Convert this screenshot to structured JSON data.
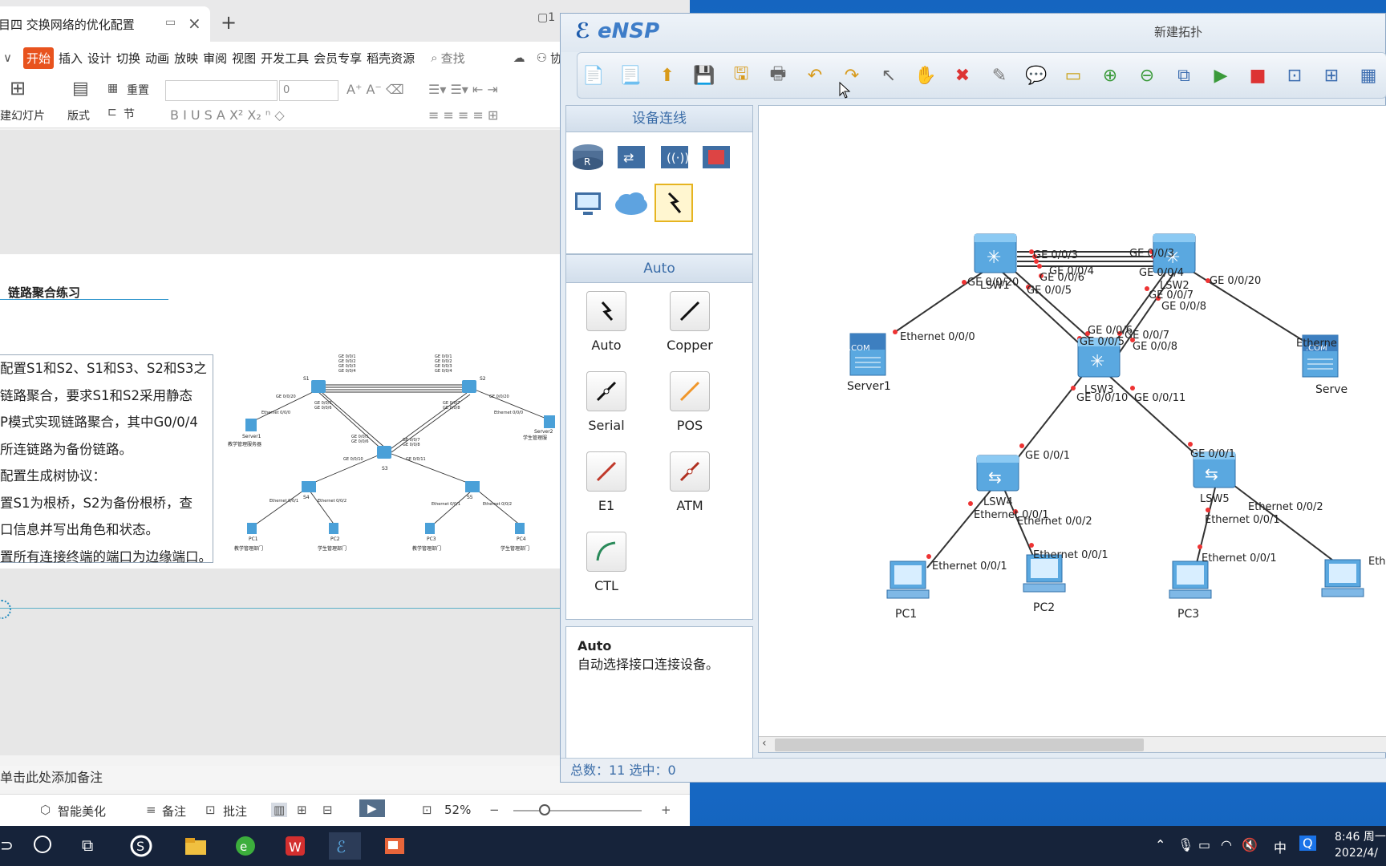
{
  "wps": {
    "tab_title": "目四 交换网络的优化配置",
    "menu": [
      "开始",
      "插入",
      "设计",
      "切换",
      "动画",
      "放映",
      "审阅",
      "视图",
      "开发工具",
      "会员专享",
      "稻壳资源"
    ],
    "search_placeholder": "查找",
    "collab_label": "协作",
    "ribbon": {
      "new_slide": "建幻灯片",
      "layout": "版式",
      "reset": "重置",
      "section": "节",
      "font_size": "0"
    },
    "slide": {
      "title": "链路聚合练习",
      "lines": [
        "配置S1和S2、S1和S3、S2和S3之",
        "链路聚合，要求S1和S2采用静态",
        "P模式实现链路聚合，其中G0/0/4",
        "所连链路为备份链路。",
        "配置生成树协议：",
        "置S1为根桥，S2为备份根桥，查",
        "口信息并写出角色和状态。",
        "置所有连接终端的端口为边缘端口。"
      ],
      "mini": {
        "s1": "S1",
        "s2": "S2",
        "s3": "S3",
        "s4": "S4",
        "s5": "S5",
        "server1": "Server1",
        "server1_dept": "教学管理服务器",
        "server2": "Server2",
        "server2_dept": "学生管理服",
        "pc1": "PC1",
        "pc2": "PC2",
        "pc3": "PC3",
        "pc4": "PC4",
        "pc1_dept": "教学管理部门",
        "pc2_dept": "学生管理部门",
        "pc3_dept": "教学管理部门",
        "pc4_dept": "学生管理部门",
        "ge_a": "GE 0/0/1",
        "ge_b": "GE 0/0/2",
        "ge_c": "GE 0/0/3",
        "ge_d": "GE 0/0/4",
        "ge20": "GE 0/0/20",
        "ge5": "GE 0/0/5",
        "ge6": "GE 0/0/6",
        "ge7": "GE 0/0/7",
        "ge8": "GE 0/0/8",
        "ge10": "GE 0/0/10",
        "ge11": "GE 0/0/11",
        "eth0": "Ethernet 0/0/0",
        "eth1": "Ethernet 0/0/1",
        "eth2": "Ethernet 0/0/2"
      }
    },
    "note": "单击此处添加备注",
    "status": {
      "beautify": "智能美化",
      "notes": "备注",
      "comment": "批注",
      "zoom": "52%"
    }
  },
  "ensp": {
    "logo": "eNSP",
    "window_title": "新建拓扑",
    "panel_title": "设备连线",
    "cable_section": "Auto",
    "cables": [
      "Auto",
      "Copper",
      "Serial",
      "POS",
      "E1",
      "ATM",
      "CTL"
    ],
    "desc_title": "Auto",
    "desc_text": "自动选择接口连接设备。",
    "status": "总数：11  选中：0",
    "topology": {
      "lsw1": "LSW1",
      "lsw2": "LSW2",
      "lsw3": "LSW3",
      "lsw4": "LSW4",
      "lsw5": "LSW5",
      "server1": "Server1",
      "server2": "Serve",
      "pc1": "PC1",
      "pc2": "PC2",
      "pc3": "PC3",
      "port_ge20_a": "GE 0/0/20",
      "port_ge20_b": "GE 0/0/20",
      "port_eth000": "Ethernet 0/0/0",
      "port_eth_r": "Etherne",
      "port_ge3": "GE 0/0/3",
      "port_ge4": "GE 0/0/4",
      "port_ge6": "GE 0/0/6",
      "port_ge5": "GE 0/0/5",
      "port_s2_a": "GE 0/0/3",
      "port_s2_b": "GE 0/0/4",
      "port_ge7": "GE 0/0/7",
      "port_ge8": "GE 0/0/8",
      "port_lsw3_6": "GE 0/0/6",
      "port_lsw3_5": "GE 0/0/5",
      "port_lsw3_7": "GE 0/0/7",
      "port_lsw3_8": "GE 0/0/8",
      "port_ge10": "GE 0/0/10",
      "port_ge11": "GE 0/0/11",
      "port_lsw4_ge1": "GE 0/0/1",
      "port_lsw5_ge1": "GE 0/0/1",
      "port_lsw4_eth1": "Ethernet 0/0/1",
      "port_lsw4_eth2": "Ethernet 0/0/2",
      "port_lsw5_eth1": "Ethernet 0/0/1",
      "port_lsw5_eth2": "Ethernet 0/0/2",
      "port_pc1": "Ethernet 0/0/1",
      "port_pc2": "Ethernet 0/0/1",
      "port_pc3": "Ethernet 0/0/1",
      "port_pc4": "Eth",
      "server_tag": ".COM"
    }
  },
  "taskbar": {
    "time": "8:46 周一",
    "date": "2022/4/",
    "ime": "中",
    "colors": {
      "bg": "#16233a"
    }
  }
}
